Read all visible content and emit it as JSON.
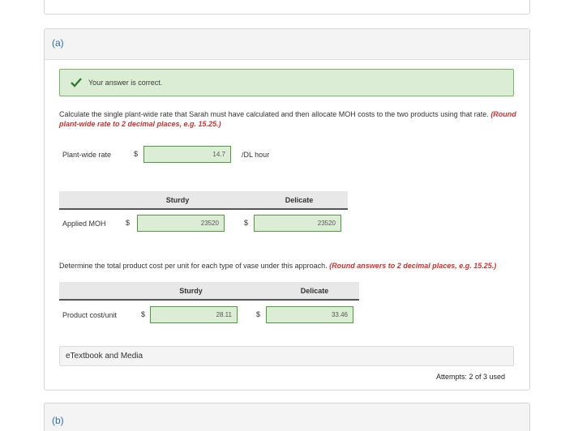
{
  "part_a": {
    "label": "(a)",
    "feedback": "Your answer is correct.",
    "instruction_main": "Calculate the single plant-wide rate that Sarah must have calculated and then allocate MOH costs to the two products using that rate.",
    "instruction_round": "(Round plant-wide rate to 2 decimal places, e.g. 15.25.)",
    "plant_wide": {
      "label": "Plant-wide rate",
      "currency": "$",
      "value": "14.7",
      "unit": "/DL hour"
    },
    "table1": {
      "headers": [
        "Sturdy",
        "Delicate"
      ],
      "row_label": "Applied MOH",
      "currency": "$",
      "values": [
        "23520",
        "23520"
      ]
    },
    "instruction2_main": "Determine the total product cost per unit for each type of vase under this approach.",
    "instruction2_round": "(Round answers to 2 decimal places, e.g. 15.25.)",
    "table2": {
      "headers": [
        "Sturdy",
        "Delicate"
      ],
      "row_label": "Product cost/unit",
      "currency": "$",
      "values": [
        "28.11",
        "33.46"
      ]
    },
    "etextbook": "eTextbook and Media",
    "attempts": "Attempts: 2 of 3 used"
  },
  "part_b": {
    "label": "(b)"
  },
  "colors": {
    "correct_bg": "#dcedd6",
    "correct_border": "#6fbf5c",
    "link_blue": "#2a6db5",
    "round_red": "#d32f2f"
  }
}
